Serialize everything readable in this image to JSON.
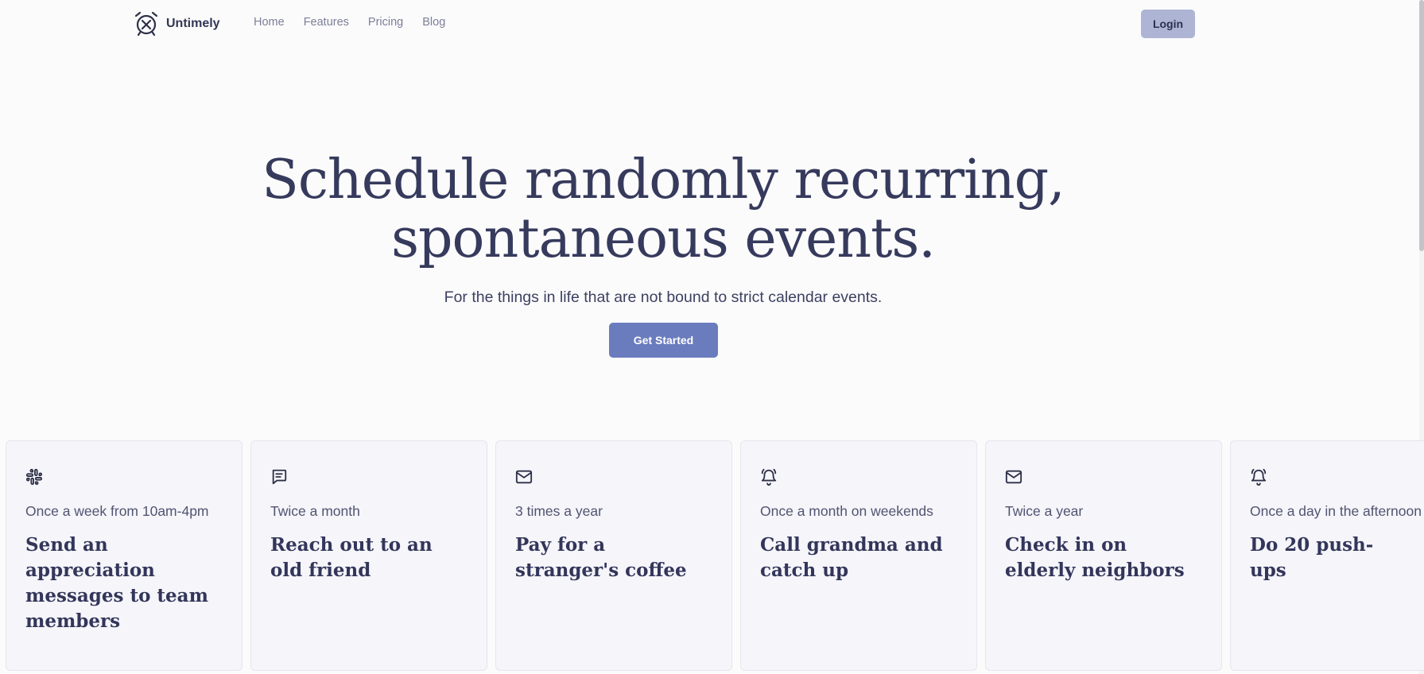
{
  "nav": {
    "brand": "Untimely",
    "links": [
      "Home",
      "Features",
      "Pricing",
      "Blog"
    ],
    "login_label": "Login"
  },
  "hero": {
    "title_line1": "Schedule randomly recurring,",
    "title_line2": "spontaneous events.",
    "subtitle": "For the things in life that are not bound to strict calendar events.",
    "cta_label": "Get Started"
  },
  "cards": [
    {
      "icon": "slack-icon",
      "frequency": "Once a week from 10am-4pm",
      "title": "Send an appreciation messages to team members"
    },
    {
      "icon": "message-icon",
      "frequency": "Twice a month",
      "title": "Reach out to an old friend"
    },
    {
      "icon": "mail-icon",
      "frequency": "3 times a year",
      "title": "Pay for a stranger's coffee"
    },
    {
      "icon": "bell-icon",
      "frequency": "Once a month on weekends",
      "title": "Call grandma and catch up"
    },
    {
      "icon": "mail-icon",
      "frequency": "Twice a year",
      "title": "Check in on elderly neighbors"
    },
    {
      "icon": "bell-icon",
      "frequency": "Once a day in the afternoon",
      "title": "Do 20 push-ups"
    }
  ],
  "colors": {
    "background": "#fbfbfc",
    "text": "#33365a",
    "accent": "#6a7cbd",
    "login_bg": "#aeb5d4",
    "card_bg": "#f5f5fa"
  }
}
